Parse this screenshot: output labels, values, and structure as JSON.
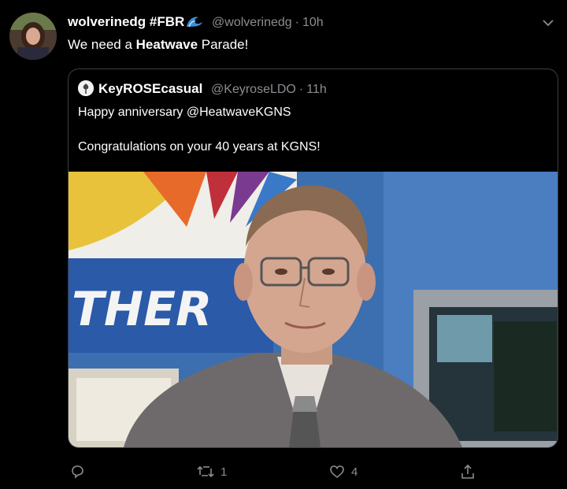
{
  "tweet": {
    "display_name": "wolverinedg #FBR",
    "handle": "@wolverinedg",
    "separator": "·",
    "time": "10h",
    "text_prefix": "We need a ",
    "text_bold": "Heatwave",
    "text_suffix": " Parade!"
  },
  "quoted": {
    "display_name": "KeyROSEcasual",
    "handle": "@KeyroseLDO",
    "separator": "·",
    "time": "11h",
    "line1": "Happy anniversary @HeatwaveKGNS",
    "line2": "Congratulations on your 40 years at KGNS!",
    "photo_sign_text": "THER"
  },
  "actions": {
    "reply_icon": "reply-icon",
    "retweet_icon": "retweet-icon",
    "retweet_count": "1",
    "like_icon": "heart-icon",
    "like_count": "4",
    "share_icon": "share-icon"
  },
  "colors": {
    "background": "#000000",
    "text": "#ffffff",
    "muted": "#8a8d91",
    "border": "#3b3e42"
  }
}
